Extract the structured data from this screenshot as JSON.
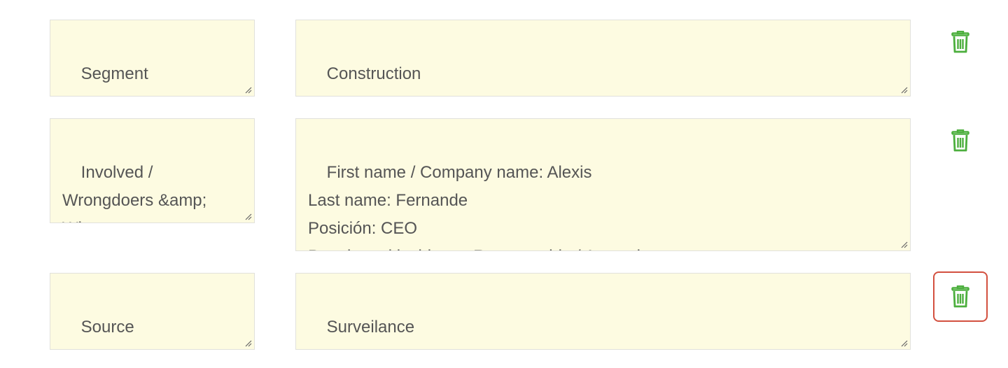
{
  "colors": {
    "field_background": "#fdfbe1",
    "field_border": "#e1e1dc",
    "text": "#555555",
    "delete_icon": "#4caf3d",
    "highlight_border": "#d3503f"
  },
  "rows": [
    {
      "key": "Segment",
      "value": "Construction",
      "delete_icon": "trash-icon"
    },
    {
      "key": "Involved /\nWrongdoers &amp;\nWitnesses",
      "value": "First name / Company name: Alexis\nLast name: Fernande\nPosición: CEO\nPapel en el incidente: Responsable / Acusado",
      "delete_icon": "trash-icon"
    },
    {
      "key": "Source",
      "value": "Surveilance",
      "delete_icon": "trash-icon",
      "highlighted": true
    }
  ]
}
